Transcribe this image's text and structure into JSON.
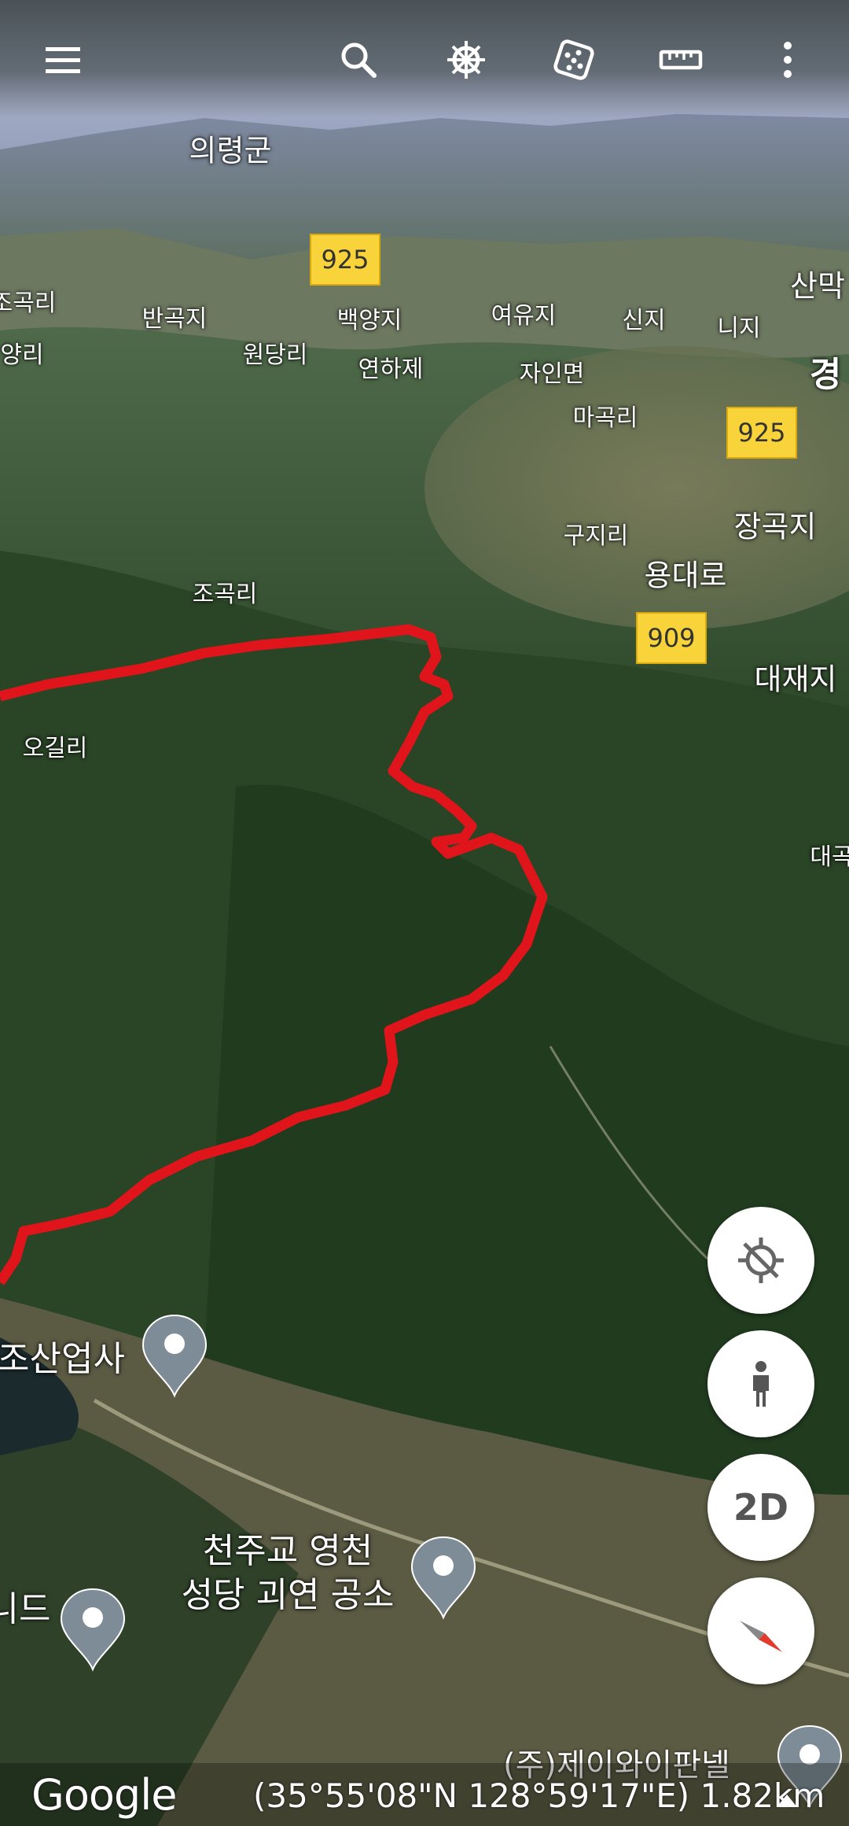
{
  "toolbar": {
    "icons": [
      "menu-icon",
      "search-icon",
      "voyager-icon",
      "feeling-lucky-dice-icon",
      "measure-ruler-icon",
      "more-vertical-icon"
    ]
  },
  "map_labels": {
    "uiryeong": "의령군",
    "jogokri_left": "조곡리",
    "bangokji": "반곡지",
    "baekyangji": "백양지",
    "yeoyuji": "여유지",
    "sinji": "신지",
    "niji": "니지",
    "sanmak": "산막",
    "yangri": "양리",
    "wondangri": "원당리",
    "yeonhaje": "연하제",
    "jainmyeon": "자인면",
    "gyeong": "경",
    "magokri": "마곡리",
    "jangokji": "장곡지",
    "gujiri": "구지리",
    "yongdaero": "용대로",
    "jogokri": "조곡리",
    "daejaeji": "대재지",
    "ogilri": "오길리",
    "daegok": "대곡",
    "poi_sanupsa": "조산업사",
    "poi_church_line1": "천주교 영천",
    "poi_church_line2": "성당 괴연 공소",
    "poi_left": "니드",
    "provider": "(주)제이와이판넬"
  },
  "road_shields": {
    "r925_a": "925",
    "r925_b": "925",
    "r909": "909"
  },
  "controls": {
    "view_mode_label": "2D",
    "icons": [
      "no-location-icon",
      "pegman-icon",
      "compass-icon"
    ]
  },
  "footer": {
    "logo": "Google",
    "coordinates": "(35°55'08\"N 128°59'17\"E) 1.82km"
  },
  "colors": {
    "route": "#e0141b",
    "shield": "#f9d33a",
    "terrain_dark": "#23391f",
    "terrain_mid": "#3d5f34",
    "sky_haze": "#9aa4bf"
  }
}
